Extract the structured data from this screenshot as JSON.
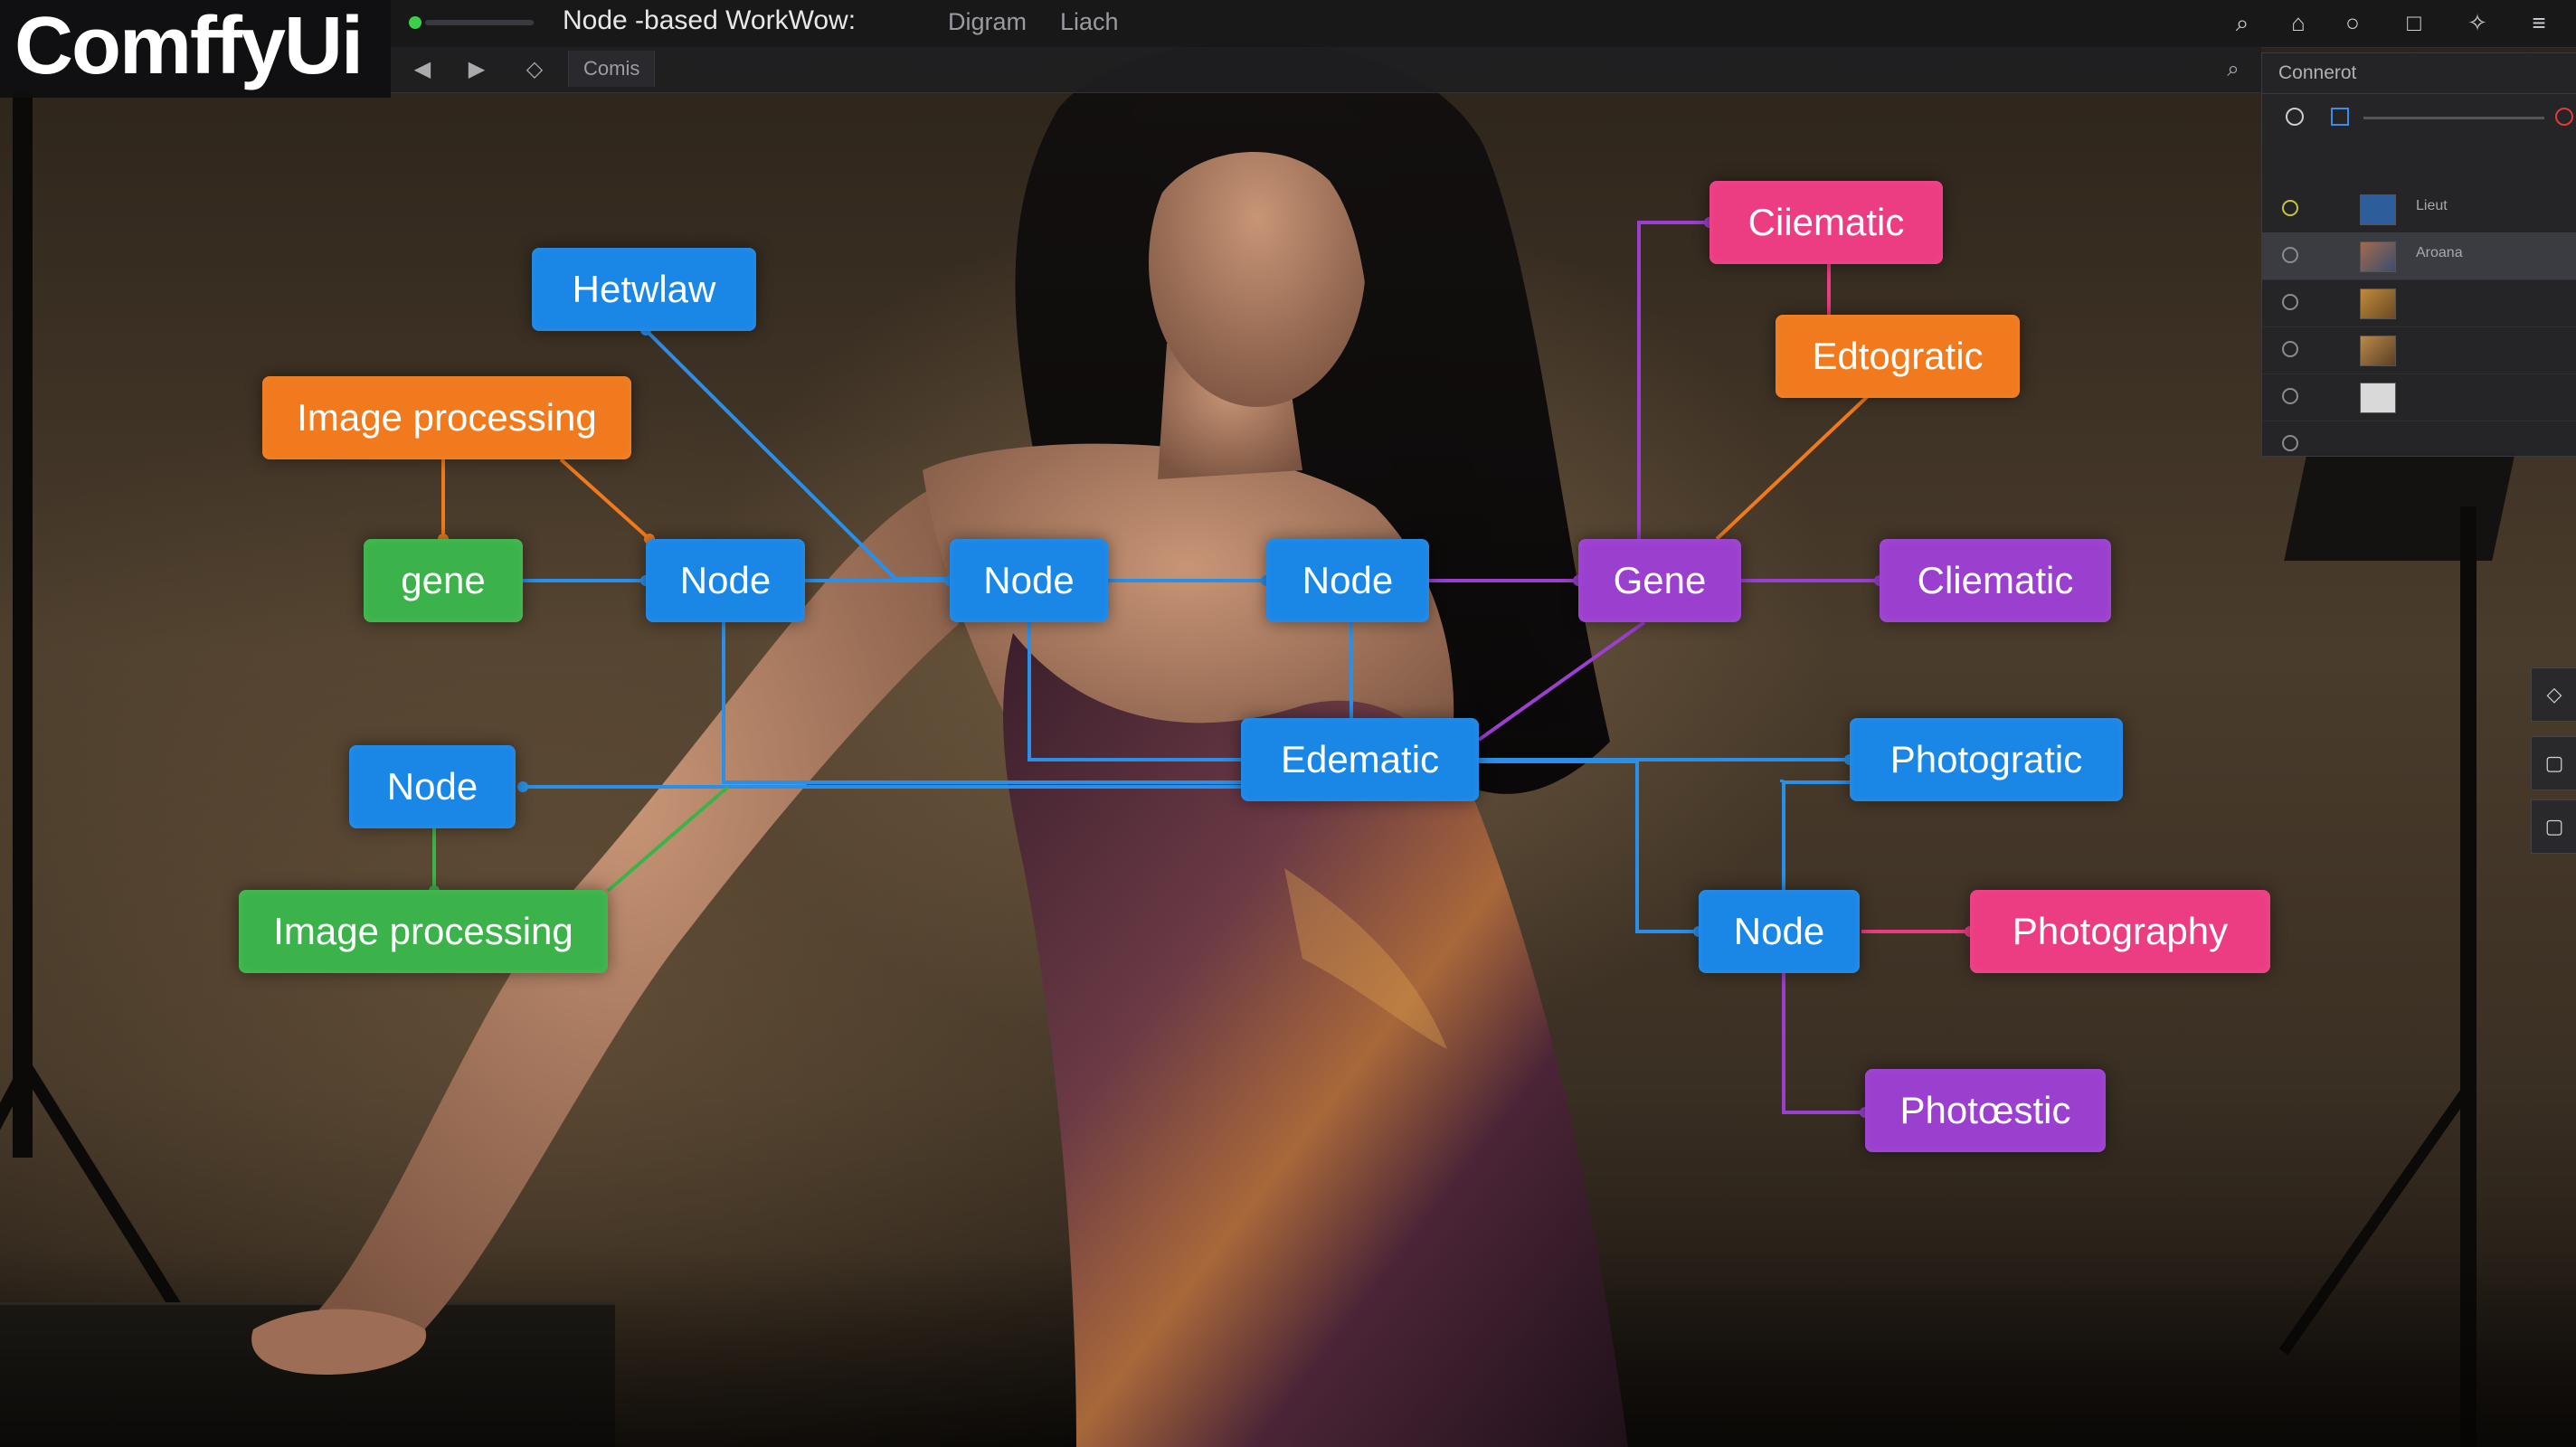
{
  "app": {
    "logo": "ComffyUi",
    "title": "Node -based  WorkWow:",
    "menu": [
      "Digram",
      "Liach"
    ],
    "subbar_tab": "Comis"
  },
  "panel": {
    "title": "Connerot",
    "layers": [
      {
        "name": "Lieut",
        "selected": false
      },
      {
        "name": "Aroana",
        "selected": true
      },
      {
        "name": "",
        "selected": false
      },
      {
        "name": "",
        "selected": false
      },
      {
        "name": "",
        "selected": false
      },
      {
        "name": "",
        "selected": false
      }
    ]
  },
  "colors": {
    "blue": "#1a86e6",
    "orange": "#f07a1d",
    "green": "#3cb34a",
    "purple": "#9b3fcf",
    "pink": "#ec3c82"
  },
  "nodes": {
    "hetwlaw": "Hetwlaw",
    "image_processing_orange": "Image processing",
    "gene_green": "gene",
    "node_left": "Node",
    "node_center": "Node",
    "node_right": "Node",
    "node_lower_left": "Node",
    "image_processing_green": "Image processing",
    "edematic": "Edematic",
    "ciiematic": "Ciiematic",
    "edtogratic": "Edtogratic",
    "gene_purple": "Gene",
    "cliematic": "Cliematic",
    "photogratic": "Photogratic",
    "node_lower_right": "Node",
    "photography": "Photography",
    "photostic": "Photœstic"
  }
}
